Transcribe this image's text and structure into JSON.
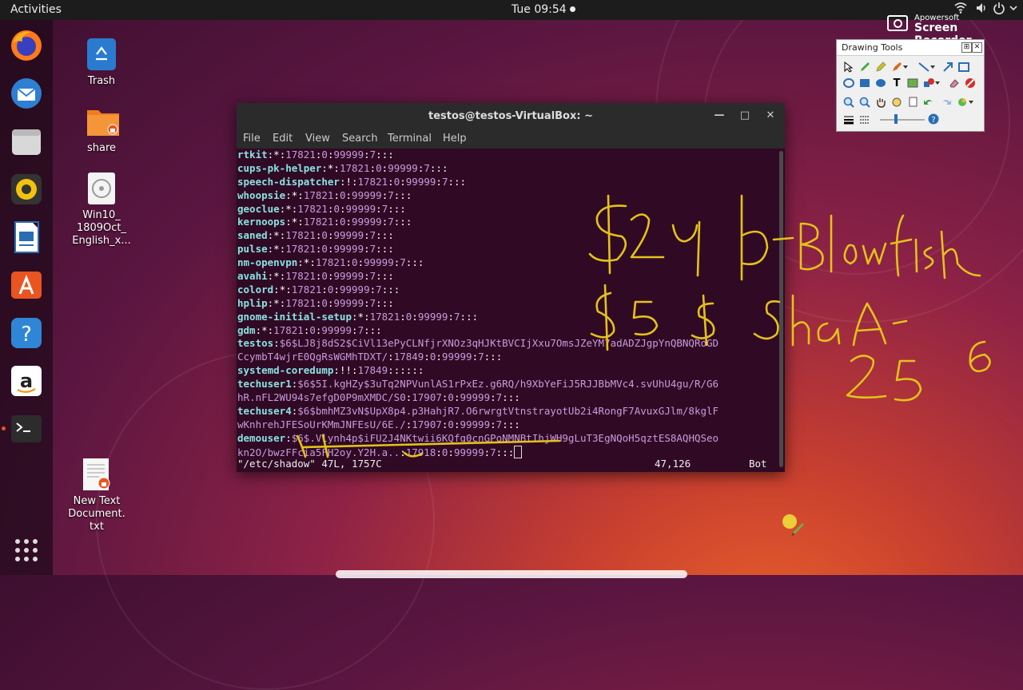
{
  "topbar": {
    "activities": "Activities",
    "clock": "Tue 09:54"
  },
  "recorder": {
    "brand_small": "Apowersoft",
    "brand_big": "Screen Recorder"
  },
  "dock": {
    "items": [
      "firefox",
      "thunderbird",
      "files",
      "rhythmbox",
      "libreoffice-writer",
      "ubuntu-software",
      "help",
      "amazon",
      "terminal"
    ],
    "show_apps": "show-applications"
  },
  "desktop": {
    "icons": [
      {
        "label": "Trash"
      },
      {
        "label": "share"
      },
      {
        "label": "Win10_\n1809Oct_\nEnglish_x..."
      },
      {
        "label": "New Text\nDocument.\ntxt"
      }
    ]
  },
  "terminal": {
    "title": "testos@testos-VirtualBox: ~",
    "menu": [
      "File",
      "Edit",
      "View",
      "Search",
      "Terminal",
      "Help"
    ],
    "status_left": "\"/etc/shadow\" 47L, 1757C",
    "status_pos": "47,126",
    "status_right": "Bot",
    "lines": [
      {
        "user": "rtkit",
        "rest": ":*:17821:0:99999:7:::"
      },
      {
        "user": "cups-pk-helper",
        "rest": ":*:17821:0:99999:7:::"
      },
      {
        "user": "speech-dispatcher",
        "rest": ":!:17821:0:99999:7:::"
      },
      {
        "user": "whoopsie",
        "rest": ":*:17821:0:99999:7:::"
      },
      {
        "user": "geoclue",
        "rest": ":*:17821:0:99999:7:::"
      },
      {
        "user": "kernoops",
        "rest": ":*:17821:0:99999:7:::"
      },
      {
        "user": "saned",
        "rest": ":*:17821:0:99999:7:::"
      },
      {
        "user": "pulse",
        "rest": ":*:17821:0:99999:7:::"
      },
      {
        "user": "nm-openvpn",
        "rest": ":*:17821:0:99999:7:::"
      },
      {
        "user": "avahi",
        "rest": ":*:17821:0:99999:7:::"
      },
      {
        "user": "colord",
        "rest": ":*:17821:0:99999:7:::"
      },
      {
        "user": "hplip",
        "rest": ":*:17821:0:99999:7:::"
      },
      {
        "user": "gnome-initial-setup",
        "rest": ":*:17821:0:99999:7:::"
      },
      {
        "user": "gdm",
        "rest": ":*:17821:0:99999:7:::"
      },
      {
        "user": "testos",
        "rest": ":$6$LJ8j8dS2$CiVl13ePyCLNfjrXNOz3qHJKtBVCIjXxu7OmsJZeYM7adADZJgpYnQBNQRoGD"
      },
      {
        "user": "",
        "rest": "CcymbT4wjrE0QgRsWGMhTDXT/:17849:0:99999:7:::"
      },
      {
        "user": "systemd-coredump",
        "rest": ":!!:17849::::::"
      },
      {
        "user": "techuser1",
        "rest": ":$6$5I.kgHZy$3uTq2NPVunlAS1rPxEz.g6RQ/h9XbYeFiJ5RJJBbMVc4.svUhU4gu/R/G6"
      },
      {
        "user": "",
        "rest": "hR.nFL2WU94s7efgD0P9mXMDC/S0:17907:0:99999:7:::"
      },
      {
        "user": "techuser4",
        "rest": ":$6$bmhMZ3vN$UpX8p4.p3HahjR7.O6rwrgtVtnstrayotUb2i4RongF7AvuxGJlm/8kglF"
      },
      {
        "user": "",
        "rest": "wKnhrehJFESoUrKMmJNFEsU/6E./:17907:0:99999:7:::"
      },
      {
        "user": "demouser",
        "rest": ":$6$.Vlynh4p$iFU2J4NKtwii6KQfg0cnGPoNMNBtIhjWH9gLuT3EgNQoH5qztES8AQHQSeo"
      },
      {
        "user": "",
        "rest": "kn2O/bwzFFcia5FH2oy.Y2H.a..:17918:0:99999:7:::"
      }
    ]
  },
  "drawing_tools": {
    "title": "Drawing Tools",
    "pin": "⊞",
    "close": "✕"
  },
  "annotation_note": "$2y b-Blowfish $5$ Sha 256",
  "colors": {
    "terminal_bg": "#300a24",
    "username": "#8ae2e2",
    "hash": "#c89bdd",
    "ubuntu_orange": "#e95420",
    "annotation_yellow": "#e3c21a"
  }
}
